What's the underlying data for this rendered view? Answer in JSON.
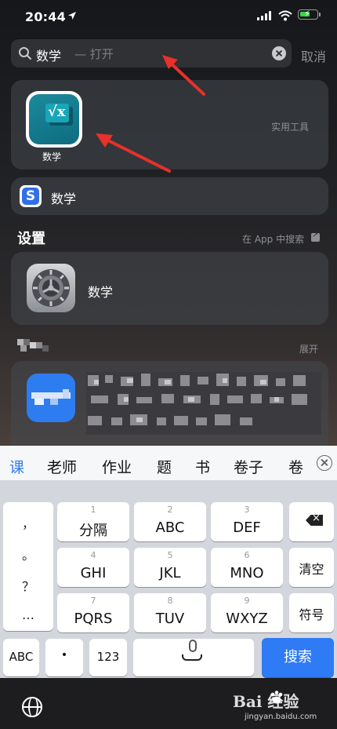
{
  "status": {
    "time": "20:44"
  },
  "search": {
    "query": "数学",
    "hint": "— 打开",
    "cancel": "取消"
  },
  "top_hit": {
    "app_name": "数学",
    "category": "实用工具"
  },
  "suggestion": {
    "text": "数学"
  },
  "settings_section": {
    "title": "设置",
    "action": "在 App 中搜索",
    "result": "数学"
  },
  "store_section": {
    "action": "展开"
  },
  "keyboard": {
    "candidates": [
      "课",
      "老师",
      "作业",
      "题",
      "书",
      "卷子",
      "卷"
    ],
    "punctuation": [
      "，",
      "。",
      "？",
      "…"
    ],
    "keys": [
      {
        "num": "1",
        "label": "分隔"
      },
      {
        "num": "2",
        "label": "ABC"
      },
      {
        "num": "3",
        "label": "DEF"
      },
      {
        "num": "4",
        "label": "GHI"
      },
      {
        "num": "5",
        "label": "JKL"
      },
      {
        "num": "6",
        "label": "MNO"
      },
      {
        "num": "7",
        "label": "PQRS"
      },
      {
        "num": "8",
        "label": "TUV"
      },
      {
        "num": "9",
        "label": "WXYZ"
      }
    ],
    "clear": "清空",
    "symbols": "符号",
    "abc": "ABC",
    "dot": "•",
    "num_mode": "123",
    "search": "搜索"
  },
  "watermark": {
    "brand": "Bai  经验",
    "url": "jingyan.baidu.com"
  },
  "colors": {
    "accent": "#2f7af5",
    "annotation": "#e8312a"
  }
}
